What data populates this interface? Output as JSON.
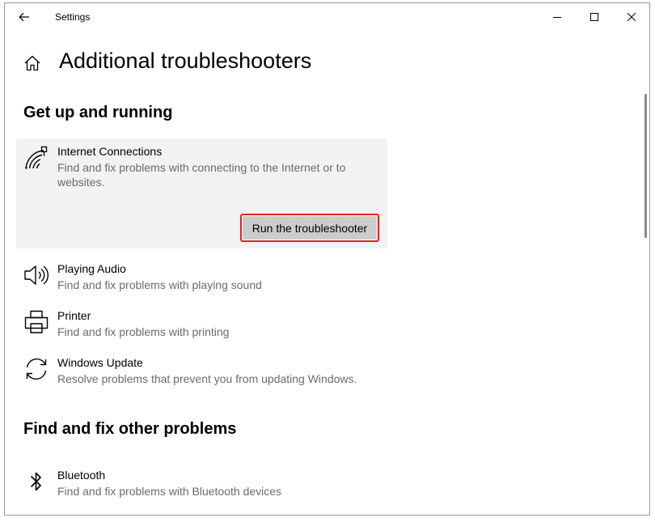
{
  "window": {
    "title": "Settings"
  },
  "header": {
    "page_title": "Additional troubleshooters"
  },
  "sections": {
    "get_up": {
      "title": "Get up and running",
      "items": [
        {
          "name": "Internet Connections",
          "description": "Find and fix problems with connecting to the Internet or to websites.",
          "icon": "wifi-icon",
          "expanded": true,
          "button_label": "Run the troubleshooter"
        },
        {
          "name": "Playing Audio",
          "description": "Find and fix problems with playing sound",
          "icon": "speaker-icon"
        },
        {
          "name": "Printer",
          "description": "Find and fix problems with printing",
          "icon": "printer-icon"
        },
        {
          "name": "Windows Update",
          "description": "Resolve problems that prevent you from updating Windows.",
          "icon": "refresh-icon"
        }
      ]
    },
    "other": {
      "title": "Find and fix other problems",
      "items": [
        {
          "name": "Bluetooth",
          "description": "Find and fix problems with Bluetooth devices",
          "icon": "bluetooth-icon"
        }
      ]
    }
  },
  "colors": {
    "highlight_border": "#e2231a",
    "expanded_background": "#f2f2f2",
    "button_background": "#cccccc"
  }
}
